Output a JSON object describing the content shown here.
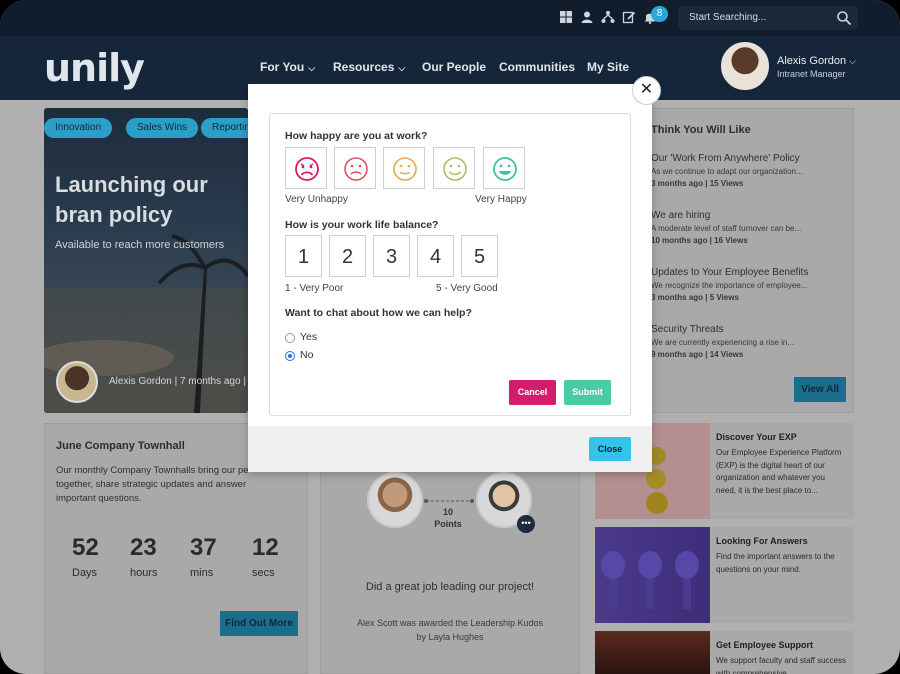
{
  "header": {
    "notification_count": "8",
    "search_placeholder": "Start Searching...",
    "logo": "unily",
    "nav": [
      {
        "label": "For You",
        "chevron": "chevron-down"
      },
      {
        "label": "Resources",
        "chevron": "chevron-down"
      },
      {
        "label": "Our People"
      },
      {
        "label": "Communities"
      },
      {
        "label": "My Site"
      }
    ],
    "user_name": "Alexis Gordon",
    "user_role": "Intranet Manager"
  },
  "hero": {
    "tags": [
      "Innovation",
      "Sales Wins",
      "Reportin"
    ],
    "title": "Launching our bran policy",
    "subtitle": "Available to reach more customers",
    "author": "Alexis Gordon | 7 months ago |"
  },
  "townhall": {
    "title": "June Company Townhall",
    "text": "Our monthly Company Townhalls bring our pe together, share strategic updates and answer important questions.",
    "countdown": [
      {
        "value": "52",
        "label": "Days"
      },
      {
        "value": "23",
        "label": "hours"
      },
      {
        "value": "37",
        "label": "mins"
      },
      {
        "value": "12",
        "label": "secs"
      }
    ],
    "button": "Find Out More"
  },
  "kudos": {
    "points_value": "10",
    "points_label": "Points",
    "title": "Did a great job leading our project!",
    "text": "Alex Scott was awarded the Leadership Kudos by Layla Hughes"
  },
  "recommended": {
    "title": "Think You Will Like",
    "items": [
      {
        "title": "Our 'Work From Anywhere' Policy",
        "excerpt": "As we continue to adapt our organization...",
        "meta": "3 months ago | 15 Views"
      },
      {
        "title": "We are hiring",
        "excerpt": "A moderate level of staff turnover can be...",
        "meta": "10 months ago | 16 Views"
      },
      {
        "title": "Updates to Your Employee Benefits",
        "excerpt": "We recognize the importance of employee...",
        "meta": "3 months ago | 5 Views"
      },
      {
        "title": "Security Threats",
        "excerpt": "We are currently experiencing a rise in...",
        "meta": "9 months ago | 14 Views"
      }
    ],
    "view_all": "View All"
  },
  "promos": [
    {
      "title": "Discover Your EXP",
      "text": "Our Employee Experience Platform (EXP) is the digital heart of our organization and whatever you need, it is the best place to..."
    },
    {
      "title": "Looking For Answers",
      "text": "Find the important answers to the questions on your mind."
    },
    {
      "title": "Get Employee Support",
      "text": "We support faculty and staff success with comprehensive"
    }
  ],
  "survey": {
    "q1": "How happy are you at work?",
    "q1_low": "Very Unhappy",
    "q1_high": "Very Happy",
    "faces": [
      {
        "icon": "very-unhappy-face-icon",
        "color": "#d81b60"
      },
      {
        "icon": "unhappy-face-icon",
        "color": "#e05060"
      },
      {
        "icon": "neutral-face-icon",
        "color": "#e6a94e"
      },
      {
        "icon": "happy-face-icon",
        "color": "#b5b86a"
      },
      {
        "icon": "very-happy-face-icon",
        "color": "#3fc1a0"
      }
    ],
    "q2": "How is your work life balance?",
    "scale": [
      "1",
      "2",
      "3",
      "4",
      "5"
    ],
    "q2_low": "1 - Very Poor",
    "q2_high": "5 - Very Good",
    "q3": "Want to chat about how we can help?",
    "options": [
      {
        "label": "Yes",
        "checked": false
      },
      {
        "label": "No",
        "checked": true
      }
    ],
    "cancel": "Cancel",
    "submit": "Submit",
    "close": "Close"
  }
}
